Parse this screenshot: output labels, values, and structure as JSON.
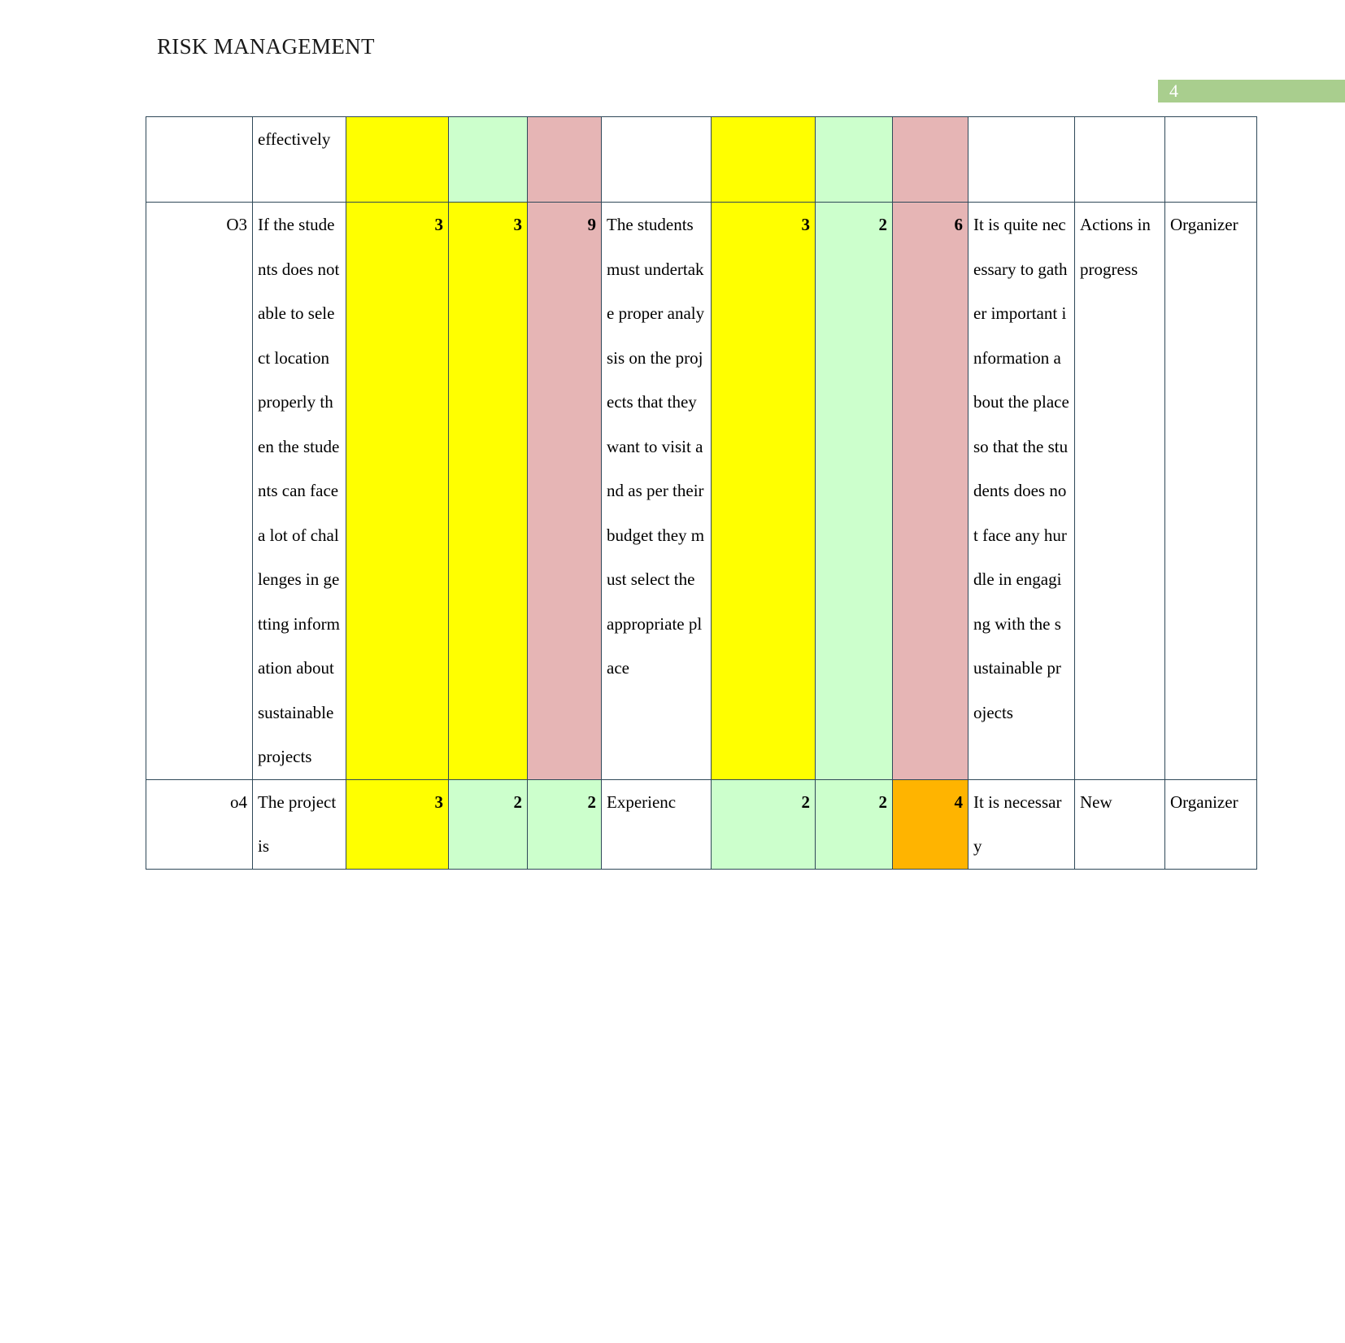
{
  "header": {
    "title": "RISK MANAGEMENT",
    "page_number": "4",
    "badge_color": "#A9CE8E"
  },
  "colors": {
    "yellow": "#FFFF00",
    "green": "#CCFFCC",
    "pink": "#E6B5B5",
    "orange": "#FFB400",
    "border": "#2F4858"
  },
  "table": {
    "rows": [
      {
        "id": "",
        "description": "effectively",
        "n1": "",
        "n2": "",
        "n3": "",
        "mitigation": "",
        "n4": "",
        "n5": "",
        "n6": "",
        "comment": "",
        "status": "",
        "owner": ""
      },
      {
        "id": "O3",
        "description": "If the students does not able to select location properly then the students can face a lot of challenges in getting information about sustainable projects",
        "n1": "3",
        "n2": "3",
        "n3": "9",
        "mitigation": "The students must undertake proper analysis on the projects that they want to visit and as per their budget they must select the appropriate place",
        "n4": "3",
        "n5": "2",
        "n6": "6",
        "comment": "It is quite necessary to gather important information about the place so that the students does not face any hurdle in engaging with the sustainable projects",
        "status": "Actions in progress",
        "owner": "Organizer"
      },
      {
        "id": "o4",
        "description": "The project is",
        "n1": "3",
        "n2": "2",
        "n3": "2",
        "mitigation": "Experienc",
        "n4": "2",
        "n5": "2",
        "n6": "4",
        "comment": "It is necessary",
        "status": "New",
        "owner": "Organizer"
      }
    ]
  }
}
